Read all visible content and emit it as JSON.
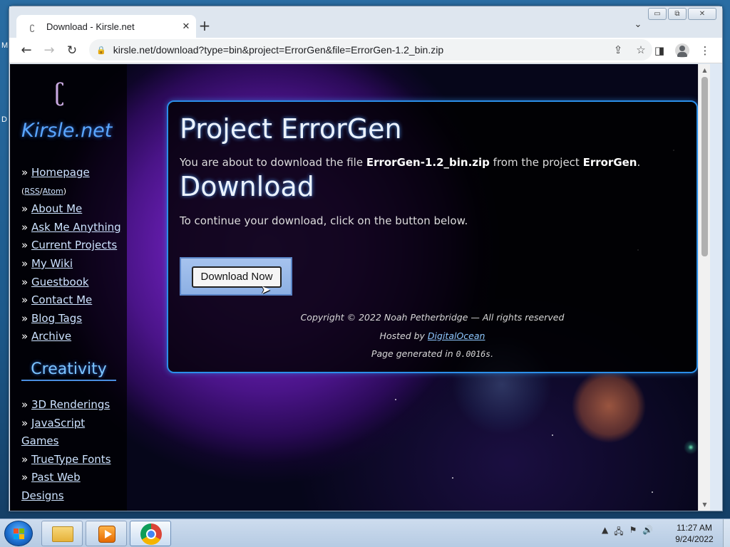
{
  "browser": {
    "tab_title": "Download - Kirsle.net",
    "tab_close": "✕",
    "new_tab": "+",
    "url": "kirsle.net/download?type=bin&project=ErrorGen&file=ErrorGen-1.2_bin.zip"
  },
  "sidebar": {
    "logo_mark": "ʗ",
    "logo_text": "Kirsle.net",
    "nav": [
      {
        "label": "Homepage"
      },
      {
        "label": "About Me"
      },
      {
        "label": "Ask Me Anything"
      },
      {
        "label": "Current Projects"
      },
      {
        "label": "My Wiki"
      },
      {
        "label": "Guestbook"
      },
      {
        "label": "Contact Me"
      },
      {
        "label": "Blog Tags"
      },
      {
        "label": "Archive"
      }
    ],
    "rss": "RSS",
    "atom": "Atom",
    "section_heading": "Creativity",
    "creativity": [
      {
        "label": "3D Renderings"
      },
      {
        "label": "JavaScript Games"
      },
      {
        "label": "TrueType Fonts"
      },
      {
        "label": "Past Web Designs"
      }
    ]
  },
  "content": {
    "heading": "Project ErrorGen",
    "intro_prefix": "You are about to download the file ",
    "file_name": "ErrorGen-1.2_bin.zip",
    "intro_middle": " from the project ",
    "project_name": "ErrorGen",
    "intro_suffix": ".",
    "subheading": "Download",
    "instruction": "To continue your download, click on the button below.",
    "button_label": "Download Now"
  },
  "footer": {
    "copyright": "Copyright © 2022 Noah Petherbridge — All rights reserved",
    "hosted_prefix": "Hosted by ",
    "host_link": "DigitalOcean",
    "generated_prefix": "Page generated in ",
    "generated_time": "0.0016s",
    "generated_suffix": "."
  },
  "taskbar": {
    "time": "11:27 AM",
    "date": "9/24/2022"
  },
  "icons": {
    "back": "back-arrow-icon",
    "forward": "forward-arrow-icon",
    "reload": "reload-icon",
    "lock": "lock-icon",
    "share": "share-icon",
    "bookmark": "star-icon",
    "sidepanel": "side-panel-icon",
    "profile": "profile-icon",
    "menu": "kebab-menu-icon"
  },
  "colors": {
    "accent": "#2b8ee8",
    "logo": "#5aa6ff",
    "link": "#cde3ff"
  }
}
